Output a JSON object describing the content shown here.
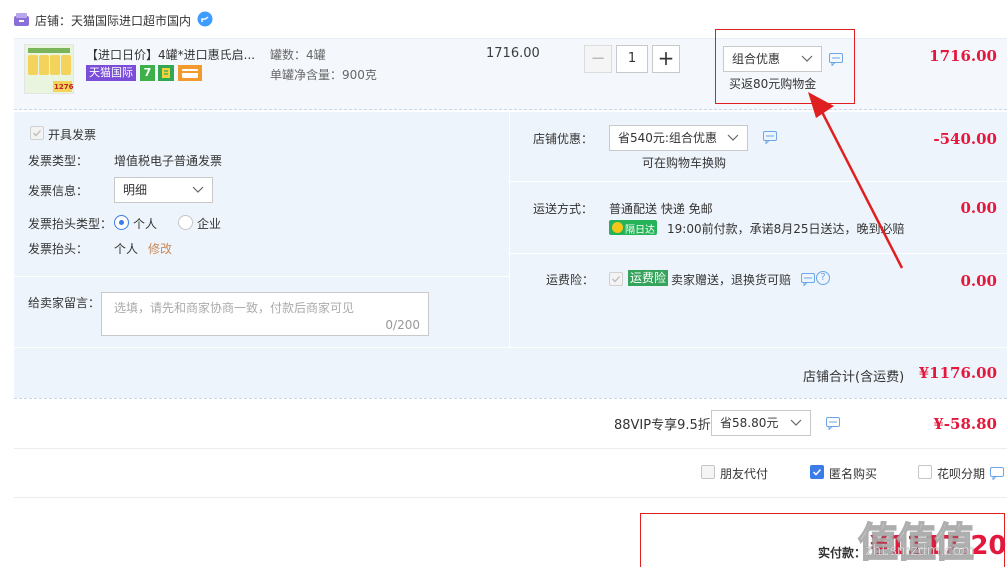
{
  "store": {
    "prefix": "店铺：",
    "name": "天猫国际进口超市国内"
  },
  "product": {
    "title": "【进口日价】4罐*进口惠氏启...",
    "badge_tmall": "天猫国际",
    "badge_7": "7",
    "thumb_price": "1276",
    "spec_count": "罐数：4罐",
    "spec_weight": "单罐净含量：900克",
    "unit_price": "1716.00",
    "quantity": "1",
    "minus": "−",
    "plus": "+",
    "promo_select": "组合优惠",
    "promo_note": "买返80元购物金",
    "total": "1716.00"
  },
  "invoice": {
    "open_label": "开具发票",
    "type_label": "发票类型：",
    "type_value": "增值税电子普通发票",
    "info_label": "发票信息：",
    "info_select": "明细",
    "header_type_label": "发票抬头类型：",
    "opt_personal": "个人",
    "opt_company": "企业",
    "header_label": "发票抬头：",
    "header_value": "个人",
    "edit_link": "修改"
  },
  "message": {
    "label": "给卖家留言：",
    "placeholder": "选填，请先和商家协商一致，付款后商家可见",
    "counter": "0/200"
  },
  "discount": {
    "label": "店铺优惠：",
    "select": "省540元:组合优惠",
    "note": "可在购物车换购",
    "amount": "-540.00"
  },
  "shipping": {
    "label": "运送方式：",
    "method": "普通配送 快递 免邮",
    "badge": "隔日达",
    "promise": "19:00前付款，承诺8月25日送达，晚到必赔",
    "amount": "0.00"
  },
  "insurance": {
    "label": "运费险：",
    "tag": "运费险",
    "desc": "卖家赠送，退换货可赔",
    "help": "?",
    "amount": "0.00"
  },
  "store_total": {
    "label": "店铺合计(含运费)",
    "amount": "¥1176.00"
  },
  "vip": {
    "label": "88VIP专享9.5折",
    "select": "省58.80元",
    "amount": "¥-58.80"
  },
  "options": {
    "friend_pay": "朋友代付",
    "anonymous": "匿名购买",
    "huabei": "花呗分期"
  },
  "payment": {
    "label": "实付款：",
    "amount": "¥1117.20"
  },
  "watermark": {
    "text": "值值值",
    "sub": "zhi.smzdm.com"
  },
  "colors": {
    "accent_red": "#e4183c",
    "panel_blue": "#eef4fb",
    "link_blue": "#3c7ce8",
    "annotation_red": "#e02020"
  }
}
